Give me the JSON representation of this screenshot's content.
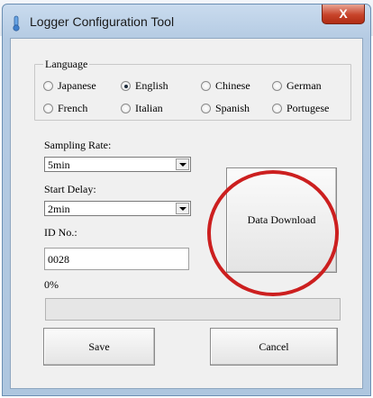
{
  "window": {
    "title": "Logger Configuration Tool",
    "close_glyph": "X"
  },
  "language": {
    "legend": "Language",
    "options": [
      {
        "label": "Japanese",
        "checked": false
      },
      {
        "label": "English",
        "checked": true
      },
      {
        "label": "Chinese",
        "checked": false
      },
      {
        "label": "German",
        "checked": false
      },
      {
        "label": "French",
        "checked": false
      },
      {
        "label": "Italian",
        "checked": false
      },
      {
        "label": "Spanish",
        "checked": false
      },
      {
        "label": "Portugese",
        "checked": false
      }
    ]
  },
  "sampling": {
    "label": "Sampling Rate:",
    "value": "5min"
  },
  "start_delay": {
    "label": "Start Delay:",
    "value": "2min"
  },
  "id": {
    "label": "ID No.:",
    "value": "0028"
  },
  "progress": {
    "text": "0%",
    "fraction": 0
  },
  "buttons": {
    "download": "Data Download",
    "save": "Save",
    "cancel": "Cancel"
  },
  "colors": {
    "annotation_circle": "#cc1f1f",
    "title_gradient": "#c9dbee"
  }
}
